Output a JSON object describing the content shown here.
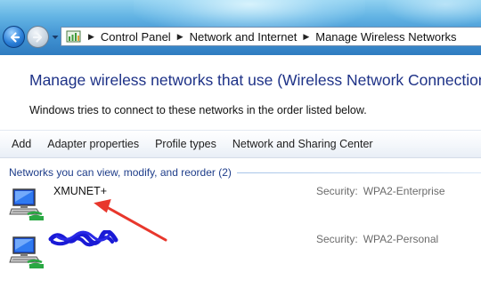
{
  "window": {
    "nav": {
      "back_icon": "back-arrow-icon",
      "forward_icon": "forward-arrow-icon",
      "recent_icon": "chevron-down-icon"
    }
  },
  "address_bar": {
    "icon": "control-panel-icon",
    "breadcrumbs": [
      {
        "label": "Control Panel"
      },
      {
        "label": "Network and Internet"
      },
      {
        "label": "Manage Wireless Networks"
      }
    ]
  },
  "header": {
    "title": "Manage wireless networks that use (Wireless Network Connection)",
    "description": "Windows tries to connect to these networks in the order listed below."
  },
  "toolbar": {
    "items": [
      {
        "label": "Add"
      },
      {
        "label": "Adapter properties"
      },
      {
        "label": "Profile types"
      },
      {
        "label": "Network and Sharing Center"
      }
    ]
  },
  "networks_group": {
    "label": "Networks you can view, modify, and reorder (2)",
    "items": [
      {
        "name": "XMUNET+",
        "security_label": "Security:",
        "security_value": "WPA2-Enterprise",
        "icon": "wireless-network-icon"
      },
      {
        "name": "",
        "name_redacted": true,
        "security_label": "Security:",
        "security_value": "WPA2-Personal",
        "icon": "wireless-network-icon"
      }
    ]
  },
  "colors": {
    "title_text": "#1e3287",
    "group_header_text": "#1e3d8a",
    "annotation_arrow": "#e8372c",
    "redaction_scribble": "#1a1ad6"
  }
}
